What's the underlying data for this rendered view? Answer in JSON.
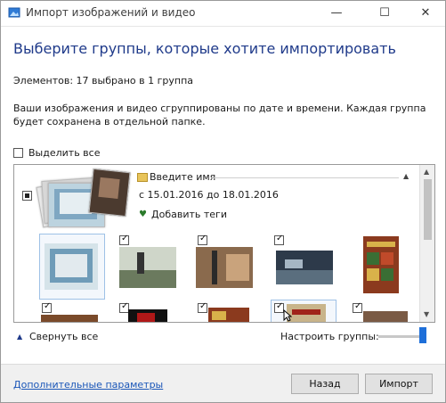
{
  "window": {
    "title": "Импорт изображений и видео",
    "controls": {
      "minimize": "—",
      "maximize": "☐",
      "close": "✕"
    }
  },
  "heading": "Выберите группы, которые хотите импортировать",
  "selection_count": "Элементов: 17 выбрано в 1 группа",
  "description": "Ваши изображения и видео сгруппированы по дате и времени. Каждая группа будет сохранена в отдельной папке.",
  "select_all": {
    "label": "Выделить все",
    "checked": false
  },
  "group": {
    "name_placeholder": "Введите имя",
    "dates": "с 15.01.2016 до 18.01.2016",
    "add_tags": "Добавить теги",
    "checked": "partial"
  },
  "thumbnails_row1_checked": [
    false,
    true,
    true,
    true,
    false
  ],
  "thumbnails_row2_checked": [
    true,
    true,
    true,
    true,
    true
  ],
  "collapse_all": "Свернуть все",
  "adjust_groups": {
    "label": "Настроить группы:",
    "level": 1.0
  },
  "footer": {
    "more_options": "Дополнительные параметры",
    "back_button": "Назад",
    "import_button": "Импорт"
  },
  "colors": {
    "heading": "#1f3a8a",
    "link": "#1a56b8",
    "slider": "#1e6fd9"
  }
}
